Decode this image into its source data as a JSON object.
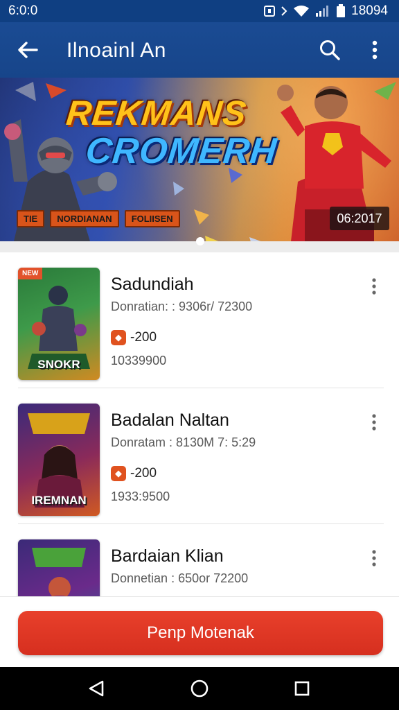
{
  "status_bar": {
    "time": "6:0:0",
    "right_text": "18094",
    "icons": [
      "nfc-icon",
      "vibrate-icon",
      "wifi-icon",
      "signal-icon",
      "battery-icon"
    ]
  },
  "app_bar": {
    "title": "Ilnoainl An",
    "icons": [
      "back-arrow-icon",
      "search-icon",
      "more-vert-icon"
    ]
  },
  "banner": {
    "title_line1": "REKMANS",
    "title_line2": "CROMERH",
    "tags": [
      "TIE",
      "NORDIANAN",
      "FOLIISEN"
    ],
    "code": "06:2017"
  },
  "items": [
    {
      "name": "Sadundiah",
      "meta": "Donratian: : 9306r/ 72300",
      "price": "-200",
      "count": "10339900",
      "thumb_label": "SNOKR",
      "thumb_tag": "NEW",
      "thumb_colors": [
        "#2a7a3a",
        "#3e9a4a",
        "#d08a22"
      ]
    },
    {
      "name": "Badalan Naltan",
      "meta": "Donratam : 8130M 7: 5:29",
      "price": "-200",
      "count": "1933:9500",
      "thumb_label": "IREMNAN",
      "thumb_tag": "",
      "thumb_colors": [
        "#3a2a7a",
        "#8a2a5a",
        "#d05a22"
      ]
    },
    {
      "name": "Bardaian Klian",
      "meta": "Donnetian : 650or 72200",
      "price": "",
      "count": "",
      "thumb_label": "",
      "thumb_tag": "",
      "thumb_colors": [
        "#3b2a78",
        "#6a2a8a",
        "#2a6aa0"
      ]
    }
  ],
  "action": {
    "label": "Penp Motenak"
  },
  "nav": {
    "icons": [
      "back-triangle-icon",
      "home-circle-icon",
      "recents-square-icon"
    ]
  },
  "colors": {
    "primary": "#17458a",
    "accent": "#d62f1f",
    "coin": "#e0521f"
  }
}
